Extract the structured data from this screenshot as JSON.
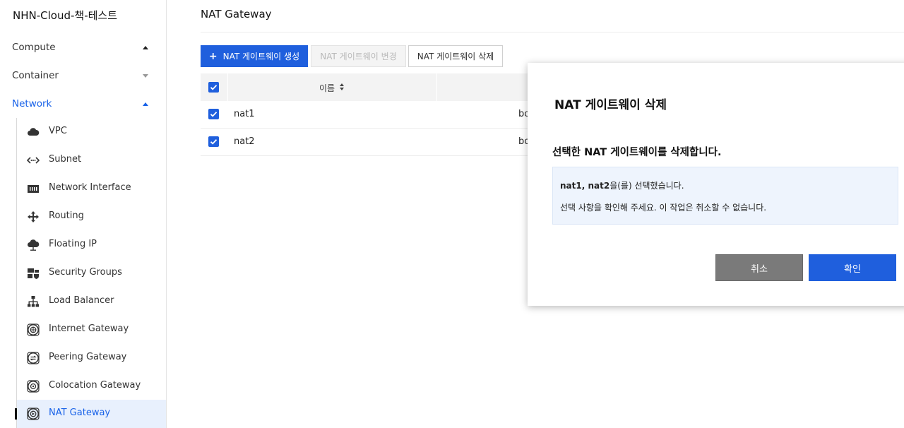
{
  "sidebar": {
    "project": "NHN-Cloud-책-테스트",
    "categories": [
      {
        "label": "Compute"
      },
      {
        "label": "Container"
      },
      {
        "label": "Network"
      }
    ],
    "network_items": [
      {
        "label": "VPC",
        "icon": "cloud-icon"
      },
      {
        "label": "Subnet",
        "icon": "subnet-icon"
      },
      {
        "label": "Network Interface",
        "icon": "nic-icon"
      },
      {
        "label": "Routing",
        "icon": "routing-icon"
      },
      {
        "label": "Floating IP",
        "icon": "floating-ip-icon"
      },
      {
        "label": "Security Groups",
        "icon": "security-groups-icon"
      },
      {
        "label": "Load Balancer",
        "icon": "load-balancer-icon"
      },
      {
        "label": "Internet Gateway",
        "icon": "gateway-icon"
      },
      {
        "label": "Peering Gateway",
        "icon": "gateway-icon"
      },
      {
        "label": "Colocation Gateway",
        "icon": "gateway-icon"
      },
      {
        "label": "NAT Gateway",
        "icon": "gateway-icon"
      }
    ],
    "selected": "NAT Gateway"
  },
  "main": {
    "title": "NAT Gateway",
    "toolbar": {
      "create_label": "NAT 게이트웨이 생성",
      "create_icon": "+",
      "edit_label": "NAT 게이트웨이 변경",
      "delete_label": "NAT 게이트웨이 삭제"
    },
    "table": {
      "col_name": "이름",
      "rows": [
        {
          "name": "nat1",
          "col2": "bo",
          "checked": true
        },
        {
          "name": "nat2",
          "col2": "bo",
          "checked": true
        }
      ]
    }
  },
  "modal": {
    "title": "NAT 게이트웨이 삭제",
    "message": "선택한 NAT 게이트웨이를 삭제합니다.",
    "selected_names": "nat1, nat2",
    "selected_suffix": "을(를) 선택했습니다.",
    "confirm_note": "선택 사항을 확인해 주세요. 이 작업은 취소할 수 없습니다.",
    "cancel_label": "취소",
    "ok_label": "확인"
  },
  "colors": {
    "accent": "#1f5fdd",
    "active_text": "#1862e8",
    "selected_bg": "#e8f0fd",
    "cancel_bg": "#7a7a7a"
  }
}
